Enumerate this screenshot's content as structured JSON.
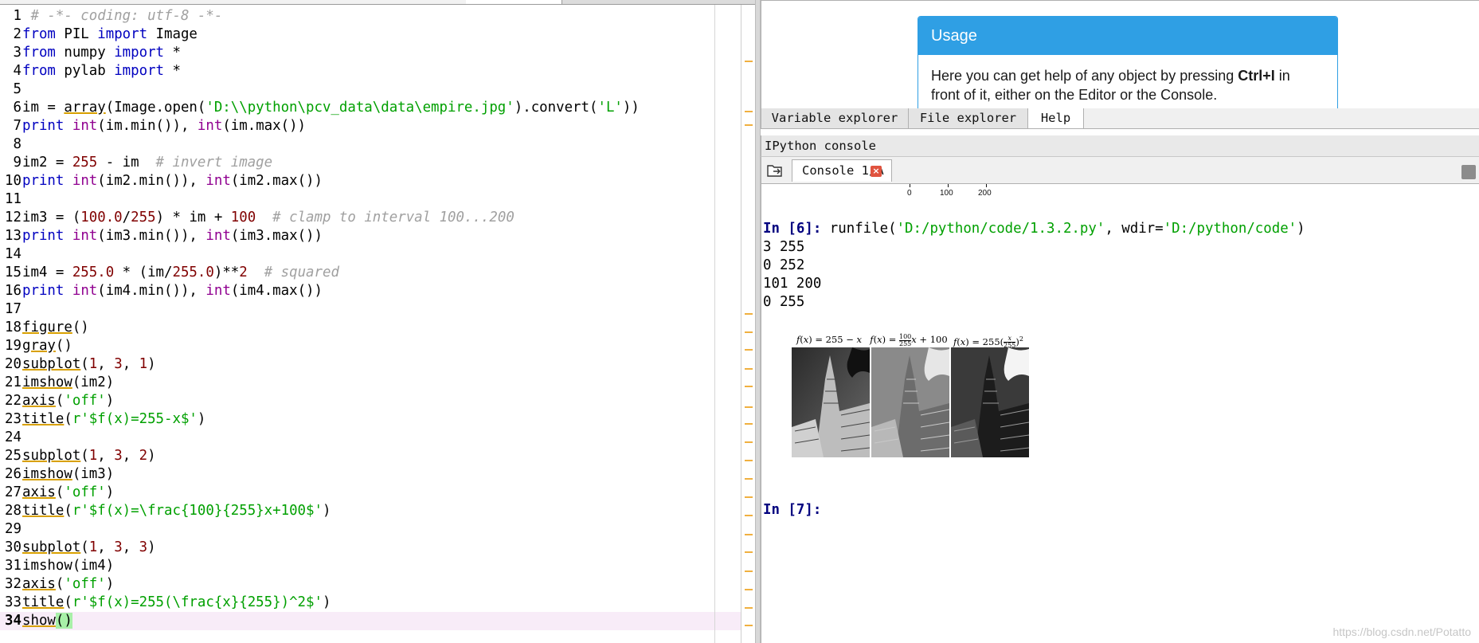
{
  "editor": {
    "current_line": 34,
    "lines": [
      {
        "n": "1"
      },
      {
        "n": "2"
      },
      {
        "n": "3"
      },
      {
        "n": "4"
      },
      {
        "n": "5"
      },
      {
        "n": "6"
      },
      {
        "n": "7"
      },
      {
        "n": "8"
      },
      {
        "n": "9"
      },
      {
        "n": "10"
      },
      {
        "n": "11"
      },
      {
        "n": "12"
      },
      {
        "n": "13"
      },
      {
        "n": "14"
      },
      {
        "n": "15"
      },
      {
        "n": "16"
      },
      {
        "n": "17"
      },
      {
        "n": "18"
      },
      {
        "n": "19"
      },
      {
        "n": "20"
      },
      {
        "n": "21"
      },
      {
        "n": "22"
      },
      {
        "n": "23"
      },
      {
        "n": "24"
      },
      {
        "n": "25"
      },
      {
        "n": "26"
      },
      {
        "n": "27"
      },
      {
        "n": "28"
      },
      {
        "n": "29"
      },
      {
        "n": "30"
      },
      {
        "n": "31"
      },
      {
        "n": "32"
      },
      {
        "n": "33"
      },
      {
        "n": "34"
      }
    ],
    "tokens": {
      "l1_comment": "# -*- coding: utf-8 -*-",
      "from": "from",
      "import": "import",
      "l2_mod": " PIL ",
      "l2_name": " Image",
      "l3_mod": " numpy ",
      "l3_name": " *",
      "l4_mod": " pylab ",
      "l4_name": " *",
      "l6_a": "im = ",
      "l6_array": "array",
      "l6_b": "(Image.open(",
      "l6_path": "'D:\\\\python\\pcv_data\\data\\empire.jpg'",
      "l6_c": ").convert(",
      "l6_L": "'L'",
      "l6_d": "))",
      "print": "print",
      "int": "int",
      "l7_a": "(im.min()), ",
      "l7_b": "(im.max())",
      "l9_a": "im2 = ",
      "l9_255": "255",
      "l9_b": " - im  ",
      "l9_cm": "# invert image",
      "l10_a": "(im2.min()), ",
      "l10_b": "(im2.max())",
      "l12_a": "im3 = (",
      "l12_n1": "100.0",
      "l12_b": "/",
      "l12_n2": "255",
      "l12_c": ") * im + ",
      "l12_n3": "100",
      "l12_d": "  ",
      "l12_cm": "# clamp to interval 100...200",
      "l13_a": "(im3.min()), ",
      "l13_b": "(im3.max())",
      "l15_a": "im4 = ",
      "l15_n1": "255.0",
      "l15_b": " * (im/",
      "l15_n2": "255.0",
      "l15_c": ")**",
      "l15_n3": "2",
      "l15_d": "  ",
      "l15_cm": "# squared",
      "l16_a": "(im4.min()), ",
      "l16_b": "(im4.max())",
      "figure": "figure",
      "gray": "gray",
      "subplot": "subplot",
      "imshow": "imshow",
      "axis": "axis",
      "title": "title",
      "show": "show",
      "parens": "()",
      "open": "(",
      "close": ")",
      "comma": ", ",
      "n1": "1",
      "n2": "2",
      "n3": "3",
      "l21_arg": "(im2)",
      "l26_arg": "(im3)",
      "l31_arg": "(im4)",
      "off": "'off'",
      "l23_str": "r'$f(x)=255-x$'",
      "l28_str": "r'$f(x)=\\frac{100}{255}x+100$'",
      "l33_str": "r'$f(x)=255(\\frac{x}{255})^2$'"
    }
  },
  "help": {
    "usage_title": "Usage",
    "usage_text_1": "Here you can get help of any object by pressing ",
    "usage_key": "Ctrl+I",
    "usage_text_2": " in",
    "usage_text_3": "front of it, either on the Editor or the Console."
  },
  "pane_tabs": [
    {
      "label": "Variable explorer",
      "active": false
    },
    {
      "label": "File explorer",
      "active": false
    },
    {
      "label": "Help",
      "active": true
    }
  ],
  "console": {
    "panel_title": "IPython console",
    "tab_label": "Console 1/A",
    "prev_ticks": [
      "0",
      "100",
      "200"
    ],
    "in6_prompt": "In [",
    "in6_num": "6",
    "in6_end": "]:",
    "in6_cmd_a": " runfile(",
    "in6_cmd_path": "'D:/python/code/1.3.2.py'",
    "in6_cmd_b": ", wdir=",
    "in6_cmd_dir": "'D:/python/code'",
    "in6_cmd_c": ")",
    "outputs": [
      "3 255",
      "0 252",
      "101 200",
      "0 255"
    ],
    "in7_prompt": "In [",
    "in7_num": "7",
    "in7_end": "]:",
    "figure_titles": [
      {
        "pre": "f",
        "mid": "(",
        "x": "x",
        "post": ") = 255 − ",
        "x2": "x"
      },
      {
        "pre": "f",
        "mid": "(",
        "x": "x",
        "frac_num": "100",
        "frac_den": "255",
        "x2": "x",
        "post": " + 100"
      },
      {
        "pre": "f",
        "mid": "(",
        "x": "x",
        "post": ") = 255(",
        "frac_num": "x",
        "frac_den": "255",
        "sup": "2"
      }
    ]
  },
  "watermark": "https://blog.csdn.net/Potatto",
  "colors": {
    "keyword": "#0000c0",
    "builtin": "#900090",
    "string": "#00a000",
    "number": "#800000",
    "comment": "#a0a0a0",
    "usage_header": "#2f9fe4",
    "current_line": "#f8ecf8",
    "close_icon": "#e0533f"
  }
}
